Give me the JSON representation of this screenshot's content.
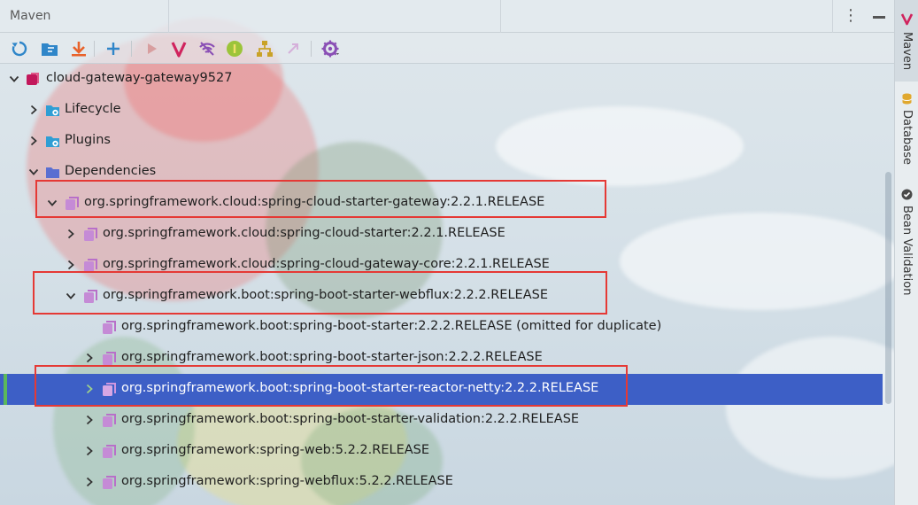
{
  "window": {
    "title": "Maven"
  },
  "toolbar": {
    "buttons": [
      {
        "name": "reload-icon"
      },
      {
        "name": "generate-sources-icon"
      },
      {
        "name": "download-icon"
      },
      {
        "name": "add-icon"
      },
      {
        "name": "run-icon"
      },
      {
        "name": "maven-goal-icon"
      },
      {
        "name": "toggle-offline-icon"
      },
      {
        "name": "skip-tests-icon"
      },
      {
        "name": "show-dependencies-icon"
      },
      {
        "name": "collapse-icon"
      },
      {
        "name": "settings-icon"
      }
    ]
  },
  "tree": {
    "root": "cloud-gateway-gateway9527",
    "lifecycle": "Lifecycle",
    "plugins": "Plugins",
    "dependencies": "Dependencies",
    "dep_gateway": "org.springframework.cloud:spring-cloud-starter-gateway:2.2.1.RELEASE",
    "dep_cloud_starter": "org.springframework.cloud:spring-cloud-starter:2.2.1.RELEASE",
    "dep_gateway_core": "org.springframework.cloud:spring-cloud-gateway-core:2.2.1.RELEASE",
    "dep_webflux_starter": "org.springframework.boot:spring-boot-starter-webflux:2.2.2.RELEASE",
    "dep_boot_starter": "org.springframework.boot:spring-boot-starter:2.2.2.RELEASE (omitted for duplicate)",
    "dep_json": "org.springframework.boot:spring-boot-starter-json:2.2.2.RELEASE",
    "dep_reactor_netty": "org.springframework.boot:spring-boot-starter-reactor-netty:2.2.2.RELEASE",
    "dep_validation": "org.springframework.boot:spring-boot-starter-validation:2.2.2.RELEASE",
    "dep_spring_web": "org.springframework:spring-web:5.2.2.RELEASE",
    "dep_spring_webflux": "org.springframework:spring-webflux:5.2.2.RELEASE"
  },
  "sidebar": {
    "tabs": [
      {
        "label": "Maven",
        "active": true
      },
      {
        "label": "Database",
        "active": false
      },
      {
        "label": "Bean Validation",
        "active": false
      }
    ]
  },
  "colors": {
    "selection": "#3d5fc6",
    "highlight_box": "#e53935",
    "maven_accent": "#c2185b",
    "dependency_icon": "#b86fc9"
  }
}
